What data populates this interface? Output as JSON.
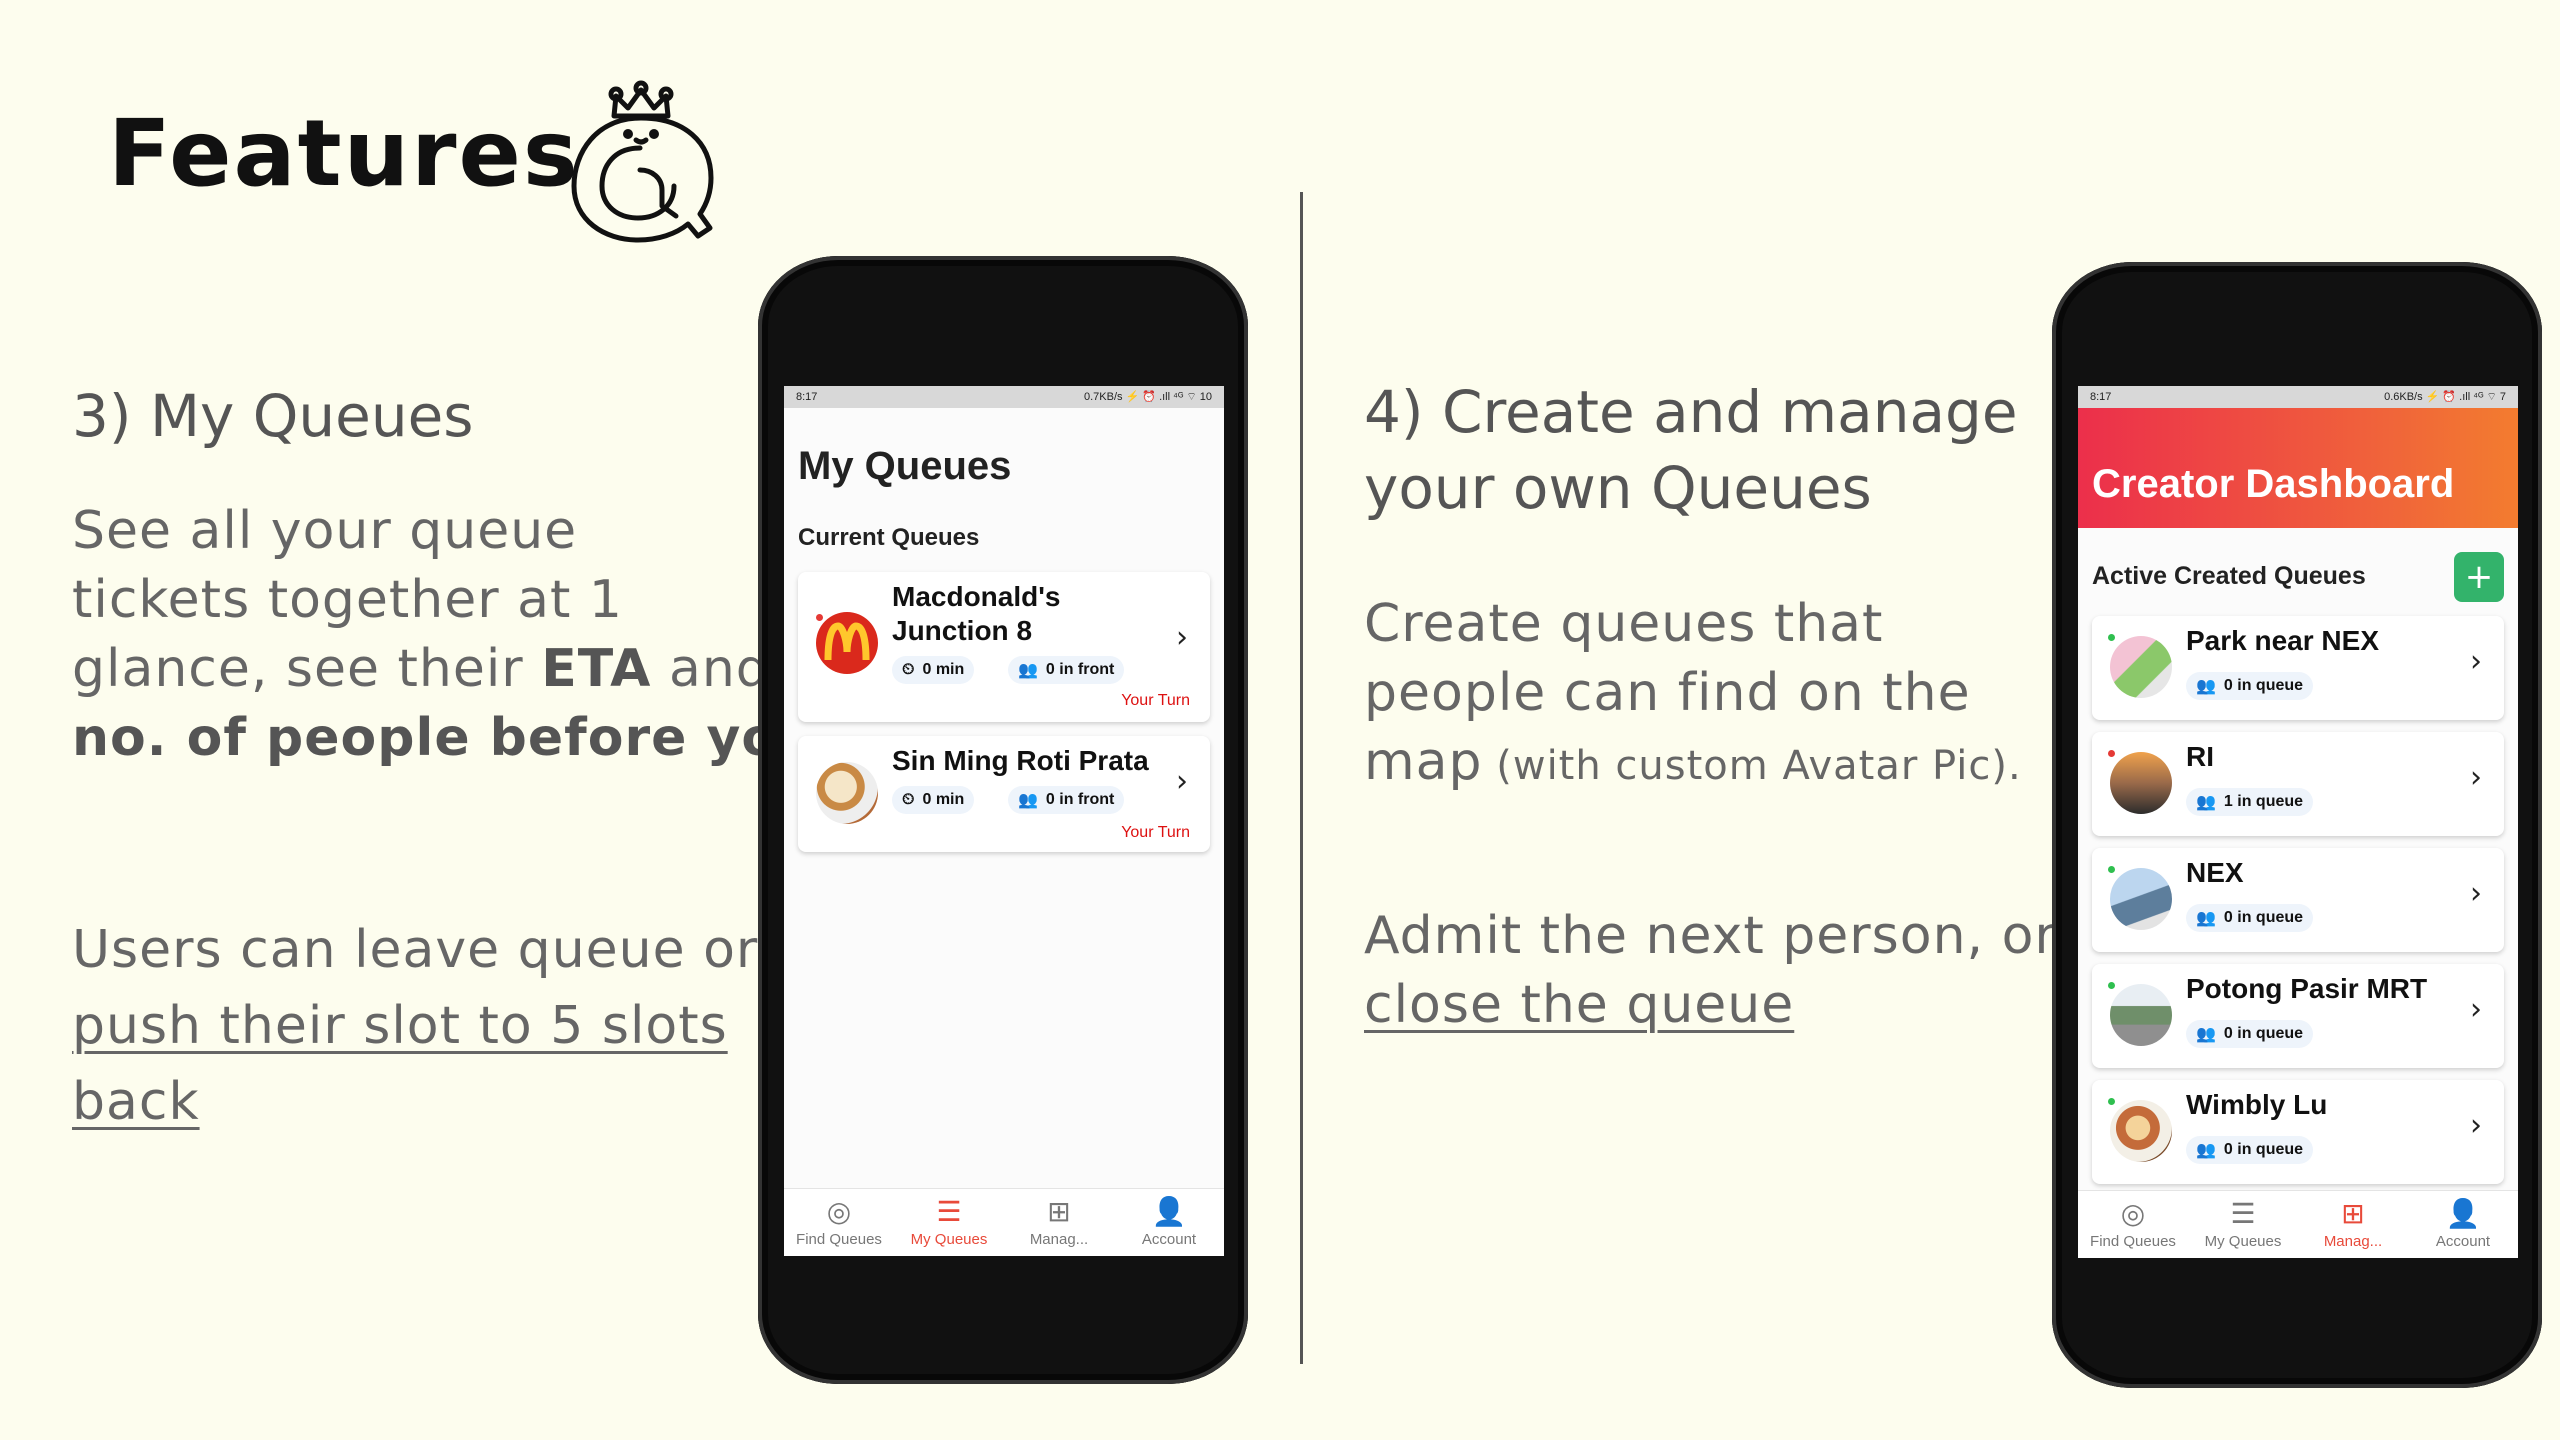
{
  "slide": {
    "title": "Features"
  },
  "left": {
    "heading": "3) My Queues",
    "p1_a": "See all your queue",
    "p1_b": "tickets together at 1",
    "p1_c1": "glance, see their ",
    "p1_c2": "ETA",
    "p1_c3": " and",
    "p1_d": "no. of people before you.",
    "p2_a": "Users can leave queue or",
    "p2_b": "push their slot to 5 slots",
    "p2_c": "back"
  },
  "right": {
    "heading_a": "4) Create and manage",
    "heading_b": "your own Queues",
    "p1_a": "Create queues that",
    "p1_b": "people can find on the",
    "p1_c1": "map",
    "p1_c2": " (with custom Avatar Pic).",
    "p2_a": "Admit the next person, or",
    "p2_b": "close the queue"
  },
  "phone1": {
    "status_time": "8:17",
    "status_right": "0.7KB/s ⚡ ⏰ .ıll ⁴ᴳ ⌔ 10",
    "title": "My Queues",
    "section": "Current Queues",
    "cards": [
      {
        "name": "Macdonald's Junction 8",
        "name_l1": "Macdonald's",
        "name_l2": "Junction 8",
        "eta": "0 min",
        "front": "0 in front",
        "status": "Your Turn"
      },
      {
        "name": "Sin Ming Roti Prata",
        "eta": "0 min",
        "front": "0 in front",
        "status": "Your Turn"
      }
    ],
    "nav": [
      "Find Queues",
      "My Queues",
      "Manag...",
      "Account"
    ]
  },
  "phone2": {
    "status_time": "8:17",
    "status_right": "0.6KB/s ⚡ ⏰ .ıll ⁴ᴳ ⌔ 7",
    "title": "Creator Dashboard",
    "section": "Active Created Queues",
    "add_label": "+",
    "queues": [
      {
        "name": "Park near NEX",
        "count": "0 in queue",
        "dot": "#2fbf4f"
      },
      {
        "name": "RI",
        "count": "1 in queue",
        "dot": "#e53935"
      },
      {
        "name": "NEX",
        "count": "0 in queue",
        "dot": "#2fbf4f"
      },
      {
        "name": "Potong Pasir MRT",
        "count": "0 in queue",
        "dot": "#2fbf4f"
      },
      {
        "name": "Wimbly Lu",
        "count": "0 in queue",
        "dot": "#2fbf4f"
      }
    ],
    "nav": [
      "Find Queues",
      "My Queues",
      "Manag...",
      "Account"
    ]
  },
  "colors": {
    "background": "#fdfdee",
    "accent": "#e84a3a",
    "header_gradient_start": "#ec2f4b",
    "header_gradient_end": "#f37c2f",
    "add_button": "#33b36b"
  }
}
